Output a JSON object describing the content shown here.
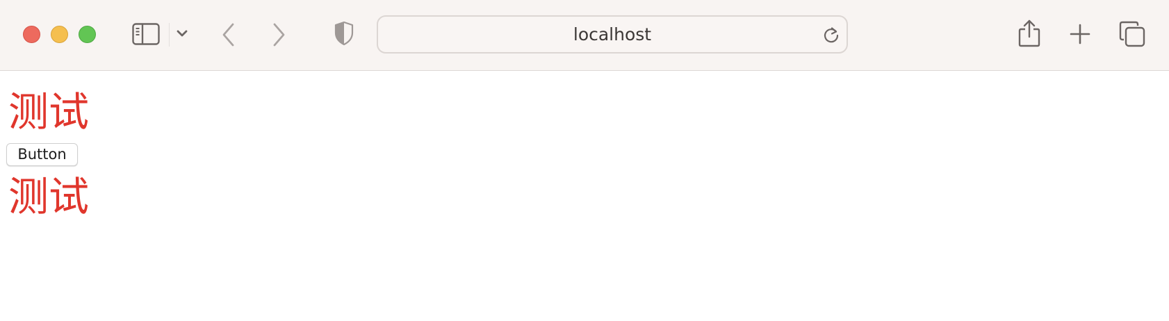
{
  "browser": {
    "address": "localhost",
    "icons": {
      "close": "close-window-dot",
      "minimize": "minimize-window-dot",
      "maximize": "maximize-window-dot",
      "sidebar": "sidebar-icon",
      "tab_group_menu": "chevron-down-icon",
      "back": "chevron-left-icon",
      "forward": "chevron-right-icon",
      "privacy": "shield-icon",
      "reload": "reload-icon",
      "share": "share-icon",
      "new_tab": "plus-icon",
      "tab_overview": "tabs-overview-icon"
    },
    "colors": {
      "toolbar_bg": "#f8f4f2",
      "close": "#ed6a5e",
      "minimize": "#f5bf4f",
      "maximize": "#62c554"
    }
  },
  "page": {
    "heading_1": "测试",
    "button_label": "Button",
    "heading_2": "测试",
    "colors": {
      "heading": "#e0362c"
    }
  }
}
